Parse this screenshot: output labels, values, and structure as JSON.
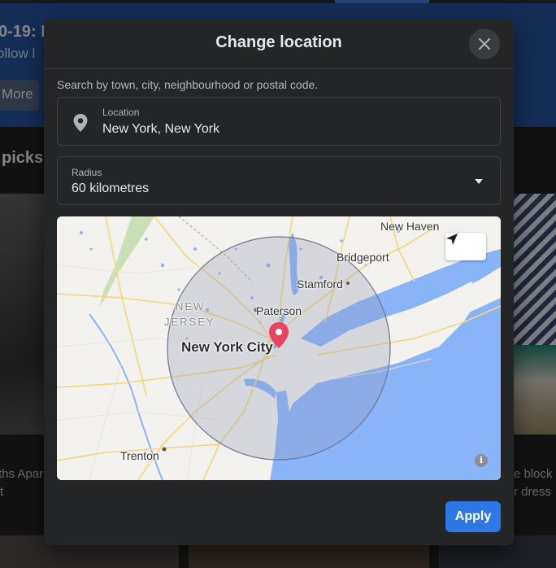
{
  "background": {
    "banner_title": "0-19: I",
    "banner_subtitle": "ollow l",
    "more_button": "More",
    "section_title": "picks",
    "left_card_text_1": "ths Apar",
    "left_card_text_2": "t",
    "right_card_text_1": "e block",
    "right_card_text_2": "r dress"
  },
  "modal": {
    "title": "Change location",
    "hint": "Search by town, city, neighbourhood or postal code.",
    "location": {
      "label": "Location",
      "value": "New York, New York"
    },
    "radius": {
      "label": "Radius",
      "value": "60 kilometres"
    },
    "map": {
      "labels": {
        "new_haven": "New Haven",
        "bridgeport": "Bridgeport",
        "stamford": "Stamford",
        "paterson": "Paterson",
        "new_jersey_1": "NEW",
        "new_jersey_2": "JERSEY",
        "nyc": "New York City",
        "trenton": "Trenton"
      },
      "colors": {
        "water": "#8ab4f8",
        "land": "#f3f2ee",
        "radius_fill": "#8b93b3",
        "pin": "#e94560"
      }
    },
    "apply_button": "Apply"
  },
  "colors": {
    "modal_bg": "#242526",
    "accent": "#2d78e4",
    "text_primary": "#e4e6eb",
    "text_secondary": "#b0b3b8"
  },
  "icons": {
    "close": "close-icon",
    "location": "map-pin-icon",
    "dropdown": "caret-down-icon",
    "locate": "navigation-arrow-icon",
    "info": "info-icon"
  }
}
